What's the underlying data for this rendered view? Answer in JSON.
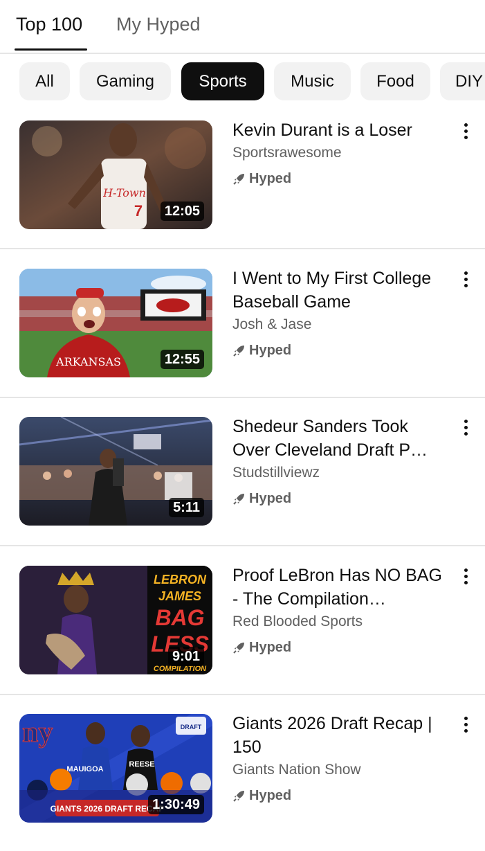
{
  "tabs": [
    {
      "label": "Top 100",
      "active": true
    },
    {
      "label": "My Hyped",
      "active": false
    }
  ],
  "chips": [
    {
      "label": "All",
      "selected": false
    },
    {
      "label": "Gaming",
      "selected": false
    },
    {
      "label": "Sports",
      "selected": true
    },
    {
      "label": "Music",
      "selected": false
    },
    {
      "label": "Food",
      "selected": false
    },
    {
      "label": "DIY",
      "selected": false
    }
  ],
  "videos": [
    {
      "title": "Kevin Durant is a Loser",
      "channel": "Sportsrawesome",
      "badge": "Hyped",
      "duration": "12:05"
    },
    {
      "title": "I Went to My First College Baseball Game",
      "channel": "Josh & Jase",
      "badge": "Hyped",
      "duration": "12:55"
    },
    {
      "title": "Shedeur Sanders Took Over Cleveland Draft P…",
      "channel": "Studstillviewz",
      "badge": "Hyped",
      "duration": "5:11"
    },
    {
      "title": "Proof LeBron Has NO BAG - The Compilation…",
      "channel": "Red Blooded Sports",
      "badge": "Hyped",
      "duration": "9:01"
    },
    {
      "title": "Giants 2026 Draft Recap | 150",
      "channel": "Giants Nation Show",
      "badge": "Hyped",
      "duration": "1:30:49"
    }
  ],
  "thumb_text": {
    "jersey1": "H-Town",
    "jersey_number": "7",
    "shirt2": "ARKANSAS",
    "lebron_lines": [
      "LEBRON",
      "JAMES",
      "BAG",
      "LESS",
      "COMPILATION"
    ],
    "giants_logo": "ny",
    "giants_banner": "GIANTS 2026 DRAFT RECAP",
    "player_a": "MAUIGOA",
    "player_b": "REESE",
    "draft_badge": "DRAFT"
  },
  "icons": {
    "badge_icon": "hype-rocket-icon",
    "menu_icon": "more-vert-icon"
  },
  "colors": {
    "selected_chip": "#0f0f0f",
    "chip_bg": "#f2f2f2",
    "secondary_text": "#606060",
    "divider": "#e5e5e5"
  }
}
